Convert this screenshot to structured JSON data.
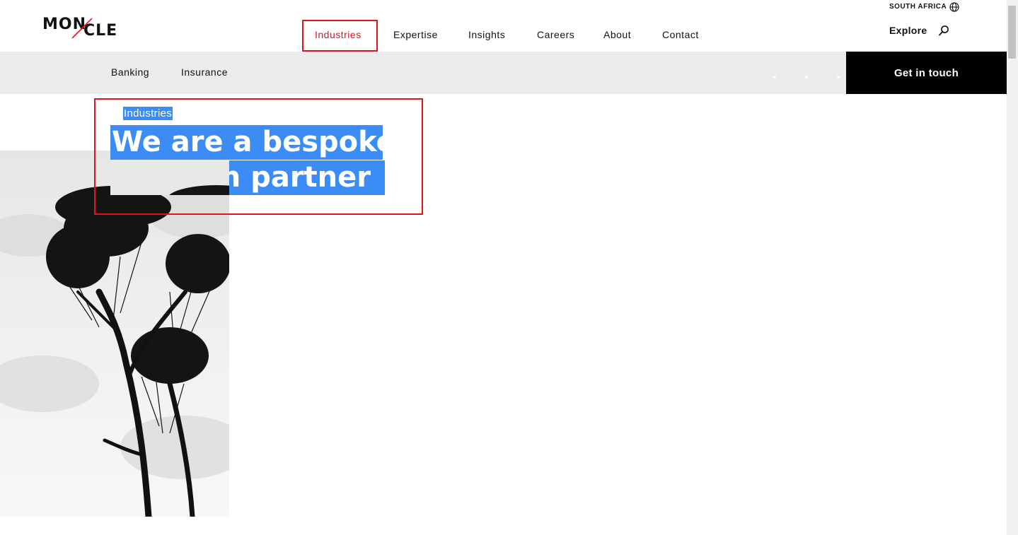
{
  "header": {
    "logo": {
      "left": "MON",
      "right": "CLE"
    },
    "nav": [
      {
        "label": "Industries",
        "active": true
      },
      {
        "label": "Expertise"
      },
      {
        "label": "Insights"
      },
      {
        "label": "Careers"
      },
      {
        "label": "About"
      },
      {
        "label": "Contact"
      }
    ],
    "region": "SOUTH AFRICA",
    "explore": "Explore"
  },
  "subnav": {
    "items": [
      {
        "label": "Banking"
      },
      {
        "label": "Insurance"
      }
    ],
    "cta": "Get in touch"
  },
  "hero": {
    "eyebrow": "Industries",
    "headline_line1": "We are a bespoke",
    "headline_line2": "solution partner"
  },
  "colors": {
    "accent": "#e1141d",
    "highlight": "#3b8cf5",
    "subnav_bg": "#ececec",
    "cta_bg": "#000000"
  },
  "icons": [
    "globe-icon",
    "search-icon"
  ]
}
